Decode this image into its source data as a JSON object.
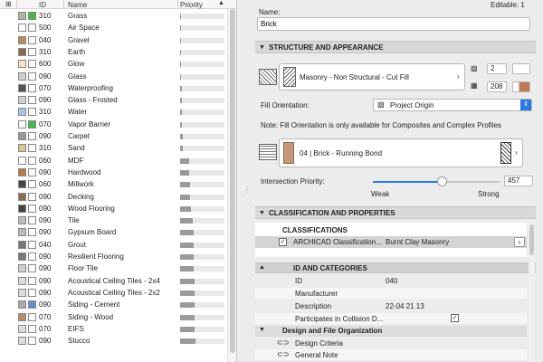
{
  "header": {
    "id": "ID",
    "name": "Name",
    "priority": "Priority",
    "sort_icon": "sort-up-triangle"
  },
  "rows": [
    {
      "sw": "#aab79f",
      "sw2": "#44b944",
      "id": "310",
      "name": "Grass",
      "p": 0.02
    },
    {
      "sw": "#ffffff",
      "sw2": "#ffffff",
      "id": "500",
      "name": "Air Space",
      "p": 0.01
    },
    {
      "sw": "#b98a64",
      "sw2": "#ffffff",
      "id": "040",
      "name": "Gravel",
      "p": 0.02
    },
    {
      "sw": "#8a6a4a",
      "sw2": "#ffffff",
      "id": "310",
      "name": "Earth",
      "p": 0.02
    },
    {
      "sw": "#f6e3c4",
      "sw2": "#ffffff",
      "id": "600",
      "name": "Glow",
      "p": 0.03
    },
    {
      "sw": "#cfcfcf",
      "sw2": "#ffffff",
      "id": "090",
      "name": "Glass",
      "p": 0.03
    },
    {
      "sw": "#555555",
      "sw2": "#ffffff",
      "id": "070",
      "name": "Waterproofing",
      "p": 0.04
    },
    {
      "sw": "#cfcfcf",
      "sw2": "#ffffff",
      "id": "090",
      "name": "Glass - Frosted",
      "p": 0.04
    },
    {
      "sw": "#a9c2ea",
      "sw2": "#ffffff",
      "id": "310",
      "name": "Water",
      "p": 0.05
    },
    {
      "sw": "#ffffff",
      "sw2": "#3fbe3f",
      "id": "070",
      "name": "Vapor Barrier",
      "p": 0.05
    },
    {
      "sw": "#9a9a9a",
      "sw2": "#ffffff",
      "id": "090",
      "name": "Carpet",
      "p": 0.06
    },
    {
      "sw": "#d9c48a",
      "sw2": "#ffffff",
      "id": "310",
      "name": "Sand",
      "p": 0.06
    },
    {
      "sw": "#ffffff",
      "sw2": "#ffffff",
      "id": "060",
      "name": "MDF",
      "p": 0.2
    },
    {
      "sw": "#b87a4a",
      "sw2": "#ffffff",
      "id": "090",
      "name": "Hardwood",
      "p": 0.2
    },
    {
      "sw": "#444444",
      "sw2": "#ffffff",
      "id": "060",
      "name": "Millwork",
      "p": 0.22
    },
    {
      "sw": "#8a6a4a",
      "sw2": "#ffffff",
      "id": "090",
      "name": "Decking",
      "p": 0.22
    },
    {
      "sw": "#444444",
      "sw2": "#ffffff",
      "id": "090",
      "name": "Wood Flooring",
      "p": 0.24
    },
    {
      "sw": "#bbbbbb",
      "sw2": "#ffffff",
      "id": "090",
      "name": "Tile",
      "p": 0.28
    },
    {
      "sw": "#bbbbbb",
      "sw2": "#ffffff",
      "id": "090",
      "name": "Gypsum Board",
      "p": 0.3
    },
    {
      "sw": "#777777",
      "sw2": "#ffffff",
      "id": "040",
      "name": "Grout",
      "p": 0.3
    },
    {
      "sw": "#777777",
      "sw2": "#ffffff",
      "id": "090",
      "name": "Resilient Flooring",
      "p": 0.3
    },
    {
      "sw": "#cfcfcf",
      "sw2": "#ffffff",
      "id": "090",
      "name": "Floor Tile",
      "p": 0.3
    },
    {
      "sw": "#dddddd",
      "sw2": "#ffffff",
      "id": "090",
      "name": "Acoustical Ceiling Tiles - 2x4",
      "p": 0.32
    },
    {
      "sw": "#dddddd",
      "sw2": "#ffffff",
      "id": "090",
      "name": "Acoustical Ceiling Tiles - 2x2",
      "p": 0.32
    },
    {
      "sw": "#aaaaaa",
      "sw2": "#5f8fd6",
      "id": "090",
      "name": "Siding - Cement",
      "p": 0.32
    },
    {
      "sw": "#b98a64",
      "sw2": "#ffffff",
      "id": "070",
      "name": "Siding - Wood",
      "p": 0.32
    },
    {
      "sw": "#dddddd",
      "sw2": "#ffffff",
      "id": "070",
      "name": "EIFS",
      "p": 0.32
    },
    {
      "sw": "#dddddd",
      "sw2": "#ffffff",
      "id": "090",
      "name": "Stucco",
      "p": 0.34
    }
  ],
  "editable": "Editable: 1",
  "name_label": "Name:",
  "name_value": "Brick",
  "sections": {
    "struct": "STRUCTURE AND APPEARANCE",
    "class": "CLASSIFICATION AND PROPERTIES"
  },
  "cut_fill": "Masonry - Non Structural - Cut Fill",
  "pen1": "2",
  "pen2": "208",
  "fill_orientation_label": "Fill Orientation:",
  "fill_orientation_value": "Project Origin",
  "note": "Note: Fill Orientation is only available for Composites and Complex Profiles",
  "surface": "04 | Brick - Running Bond",
  "intersection_label": "Intersection Priority:",
  "intersection_value": "457",
  "slider_level": 0.55,
  "weak": "Weak",
  "strong": "Strong",
  "classifications_header": "CLASSIFICATIONS",
  "classification_system": "ARCHICAD Classification...",
  "classification_value": "Burnt Clay Masonry",
  "id_categories": "ID AND CATEGORIES",
  "props": [
    {
      "label": "ID",
      "value": "040"
    },
    {
      "label": "Manufacturer",
      "value": ""
    },
    {
      "label": "Description",
      "value": "22-04 21 13"
    },
    {
      "label": "Participates in Collision D...",
      "value": ""
    }
  ],
  "design_group": "Design and File Organization",
  "design_criteria": "Design Criteria",
  "general_note": "General Note",
  "colors": {
    "accent": "#2a78e4",
    "brick": "#c8977a"
  }
}
